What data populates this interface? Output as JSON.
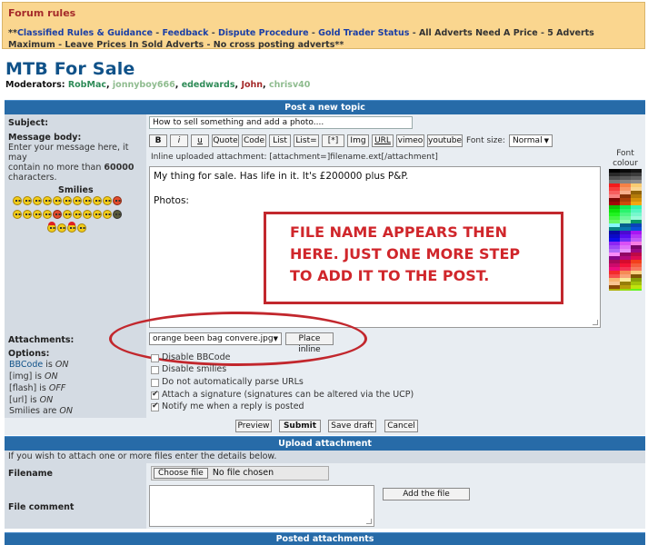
{
  "rules": {
    "title": "Forum rules",
    "prefix": "**",
    "links": [
      "Classified Rules & Guidance",
      "Feedback",
      "Dispute Procedure",
      "Gold Trader Status"
    ],
    "plain": [
      "All Adverts Need A Price",
      "5 Adverts Maximum",
      "Leave Prices In Sold Adverts",
      "No cross posting adverts**"
    ],
    "sep": " - "
  },
  "forum": {
    "title": "MTB For Sale",
    "moderators_label": "Moderators:",
    "moderators": [
      "RobMac",
      "jonnyboy666",
      "ededwards",
      "John",
      "chrisv40"
    ],
    "mod_colors": [
      "#2e8b57",
      "#8fbc8f",
      "#2e8b57",
      "#a52a2a",
      "#8fbc8f"
    ]
  },
  "post": {
    "header": "Post a new topic",
    "subject_label": "Subject:",
    "subject_value": "How to sell something and add a photo....",
    "body_label": "Message body:",
    "body_help_1": "Enter your message here, it may",
    "body_help_2": "contain no more than",
    "body_help_limit": "60000",
    "body_help_3": "characters.",
    "smilies_label": "Smilies",
    "toolbar": [
      "B",
      "i",
      "u",
      "Quote",
      "Code",
      "List",
      "List=",
      "[*]",
      "Img",
      "URL",
      "vimeo",
      "youtube"
    ],
    "font_size_label": "Font size:",
    "font_size_value": "Normal",
    "inline_note": "Inline uploaded attachment: [attachment=]filename.ext[/attachment]",
    "message_line_1": "My thing for sale. Has life in it. It's £200000 plus P&P.",
    "message_line_2": "Photos:",
    "font_colour_label_1": "Font",
    "font_colour_label_2": "colour",
    "annotation_line_1": "FILE NAME APPEARS THEN",
    "annotation_line_2": "HERE. JUST ONE MORE STEP",
    "annotation_line_3": "TO ADD IT TO THE POST.",
    "attachments_label": "Attachments:",
    "attachment_selected": "orange been bag convere.jpg",
    "place_inline": "Place inline",
    "options_label": "Options:",
    "bbcode_label": "BBCode",
    "bbcode_state": "ON",
    "img_label": "[img]",
    "img_state": "ON",
    "flash_label": "[flash]",
    "flash_state": "OFF",
    "url_label": "[url]",
    "url_state": "ON",
    "smilies_state_label": "Smilies are",
    "smilies_state": "ON",
    "is_word": "is",
    "options": [
      {
        "label": "Disable BBCode",
        "checked": false
      },
      {
        "label": "Disable smilies",
        "checked": false
      },
      {
        "label": "Do not automatically parse URLs",
        "checked": false
      },
      {
        "label": "Attach a signature (signatures can be altered via the UCP)",
        "checked": true
      },
      {
        "label": "Notify me when a reply is posted",
        "checked": true
      }
    ],
    "buttons": {
      "preview": "Preview",
      "submit": "Submit",
      "save_draft": "Save draft",
      "cancel": "Cancel"
    }
  },
  "upload": {
    "header": "Upload attachment",
    "help": "If you wish to attach one or more files enter the details below.",
    "filename_label": "Filename",
    "choose_file": "Choose file",
    "no_file": "No file chosen",
    "comment_label": "File comment",
    "add_file": "Add the file"
  },
  "posted": {
    "header": "Posted attachments"
  }
}
